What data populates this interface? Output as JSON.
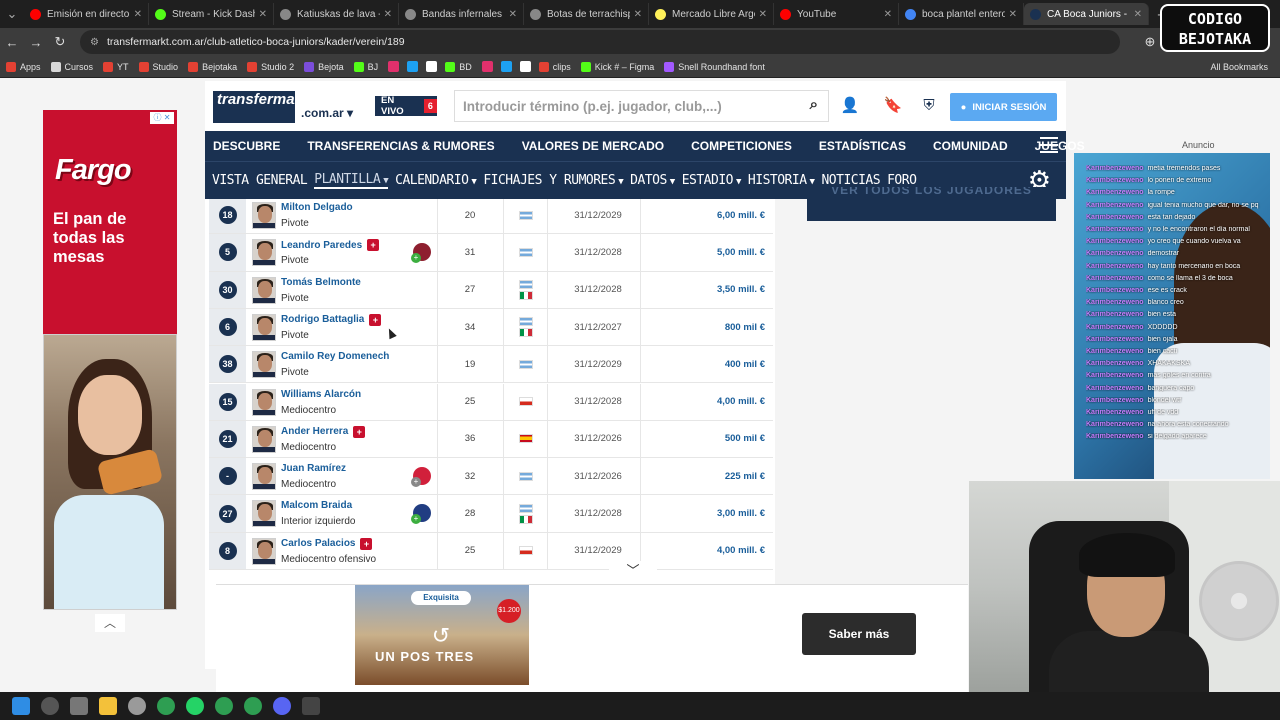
{
  "browser": {
    "tabs": [
      {
        "title": "Emisión en directo - Y",
        "color": "#ff0000"
      },
      {
        "title": "Stream - Kick Dashboard",
        "color": "#53fc18"
      },
      {
        "title": "Katiuskas de lava - W",
        "color": "#888888"
      },
      {
        "title": "Bandas infernales - W",
        "color": "#888888"
      },
      {
        "title": "Botas de terrachispa",
        "color": "#888888"
      },
      {
        "title": "Mercado Libre Argen",
        "color": "#fff159"
      },
      {
        "title": "YouTube",
        "color": "#ff0000"
      },
      {
        "title": "boca plantel entero",
        "color": "#4285f4"
      },
      {
        "title": "CA Boca Juniors - Pla",
        "color": "#1a3151",
        "active": true
      }
    ],
    "url": "transfermarkt.com.ar/club-atletico-boca-juniors/kader/verein/189",
    "bookmarks": [
      "Apps",
      "Cursos",
      "YT",
      "Studio",
      "Bejotaka",
      "Studio 2",
      "Bejota",
      "BJ",
      "BD",
      "clips",
      "Kick # – Figma",
      "Snell Roundhand font"
    ],
    "all_bookmarks": "All Bookmarks"
  },
  "stream_logo": {
    "line1": "CODIGO",
    "line2": "BEJOTAKA"
  },
  "ad_left": {
    "brand": "Fargo",
    "slogan": "El pan de todas las mesas"
  },
  "header": {
    "logo_text": "transfermarkt",
    "domain": ".com.ar",
    "live_label": "EN VIVO",
    "live_count": "6",
    "search_placeholder": "Introducir término (p.ej. jugador, club,...)",
    "login_label": "INICIAR SESIÓN"
  },
  "main_nav": [
    "DESCUBRE",
    "TRANSFERENCIAS & RUMORES",
    "VALORES DE MERCADO",
    "COMPETICIONES",
    "ESTADÍSTICAS",
    "COMUNIDAD",
    "JUEGOS"
  ],
  "sub_nav": [
    {
      "label": "VISTA GENERAL",
      "caret": false
    },
    {
      "label": "PLANTILLA",
      "caret": true,
      "active": true
    },
    {
      "label": "CALENDARIO",
      "caret": true
    },
    {
      "label": "FICHAJES Y RUMORES",
      "caret": true
    },
    {
      "label": "DATOS",
      "caret": true
    },
    {
      "label": "ESTADIO",
      "caret": true
    },
    {
      "label": "HISTORIA",
      "caret": true
    },
    {
      "label": "NOTICIAS",
      "caret": false
    },
    {
      "label": "FORO",
      "caret": false
    }
  ],
  "players": [
    {
      "number": "18",
      "name": "Milton Delgado",
      "position": "Pivote",
      "age": "20",
      "flags": [
        "ar"
      ],
      "contract": "31/12/2029",
      "value": "6,00 mill. €",
      "injury": false,
      "club": null
    },
    {
      "number": "5",
      "name": "Leandro Paredes",
      "position": "Pivote",
      "age": "31",
      "flags": [
        "ar"
      ],
      "contract": "31/12/2028",
      "value": "5,00 mill. €",
      "injury": true,
      "club": "roma"
    },
    {
      "number": "30",
      "name": "Tomás Belmonte",
      "position": "Pivote",
      "age": "27",
      "flags": [
        "ar",
        "it"
      ],
      "contract": "31/12/2028",
      "value": "3,50 mill. €",
      "injury": false,
      "club": null
    },
    {
      "number": "6",
      "name": "Rodrigo Battaglia",
      "position": "Pivote",
      "age": "34",
      "flags": [
        "ar",
        "it"
      ],
      "contract": "31/12/2027",
      "value": "800 mil €",
      "injury": true,
      "club": null
    },
    {
      "number": "38",
      "name": "Camilo Rey Domenech",
      "position": "Pivote",
      "age": "19",
      "flags": [
        "ar"
      ],
      "contract": "31/12/2029",
      "value": "400 mil €",
      "injury": false,
      "club": null
    },
    {
      "number": "15",
      "name": "Williams Alarcón",
      "position": "Mediocentro",
      "age": "25",
      "flags": [
        "cl"
      ],
      "contract": "31/12/2028",
      "value": "4,00 mill. €",
      "injury": false,
      "club": null
    },
    {
      "number": "21",
      "name": "Ander Herrera",
      "position": "Mediocentro",
      "age": "36",
      "flags": [
        "es"
      ],
      "contract": "31/12/2026",
      "value": "500 mil €",
      "injury": true,
      "club": null
    },
    {
      "number": "-",
      "name": "Juan Ramírez",
      "position": "Mediocentro",
      "age": "32",
      "flags": [
        "ar"
      ],
      "contract": "31/12/2026",
      "value": "225 mil €",
      "injury": false,
      "club": "estudiantes"
    },
    {
      "number": "27",
      "name": "Malcom Braida",
      "position": "Interior izquierdo",
      "age": "28",
      "flags": [
        "ar",
        "it"
      ],
      "contract": "31/12/2028",
      "value": "3,00 mill. €",
      "injury": false,
      "club": "sanlorenzo"
    },
    {
      "number": "8",
      "name": "Carlos Palacios",
      "position": "Mediocentro ofensivo",
      "age": "25",
      "flags": [
        "cl"
      ],
      "contract": "31/12/2029",
      "value": "4,00 mill. €",
      "injury": true,
      "club": null
    }
  ],
  "right_column": {
    "all_players_button": "VER TODOS LOS JUGADORES",
    "ad_label": "Anuncio"
  },
  "stream_chat": [
    {
      "user": "Karimbenzeweno",
      "msg": "metia tremendos pases"
    },
    {
      "user": "Karimbenzeweno",
      "msg": "lo ponen de extremo"
    },
    {
      "user": "Karimbenzeweno",
      "msg": "la rompe"
    },
    {
      "user": "Karimbenzeweno",
      "msg": "igual tenia mucho que dar, no se pq"
    },
    {
      "user": "Karimbenzeweno",
      "msg": "esta tan dejado"
    },
    {
      "user": "Karimbenzeweno",
      "msg": "y no le encontraron el día normal"
    },
    {
      "user": "Karimbenzeweno",
      "msg": "yo creo que cuando vuelva va"
    },
    {
      "user": "Karimbenzeweno",
      "msg": "demostrar"
    },
    {
      "user": "Karimbenzeweno",
      "msg": "hay tanto mercenario en boca"
    },
    {
      "user": "Karimbenzeweno",
      "msg": "como se llama el 3 de boca"
    },
    {
      "user": "Karimbenzeweno",
      "msg": "ese es crack"
    },
    {
      "user": "Karimbenzeweno",
      "msg": "blanco creo"
    },
    {
      "user": "Karimbenzeweno",
      "msg": "bien esta"
    },
    {
      "user": "Karimbenzeweno",
      "msg": "XDDDDD"
    },
    {
      "user": "Karimbenzeweno",
      "msg": "bien ojala"
    },
    {
      "user": "Karimbenzeweno",
      "msg": "bien cacti"
    },
    {
      "user": "Karimbenzeweno",
      "msg": "XHAKAKSKA"
    },
    {
      "user": "Karimbenzeweno",
      "msg": "más goles en contra"
    },
    {
      "user": "Karimbenzeweno",
      "msg": "banguera capo"
    },
    {
      "user": "Karimbenzeweno",
      "msg": "blondel wtf"
    },
    {
      "user": "Karimbenzeweno",
      "msg": "uff de vdd"
    },
    {
      "user": "Karimbenzeweno",
      "msg": "na ahora esta conectando"
    },
    {
      "user": "Karimbenzeweno",
      "msg": "si delgado aparece"
    }
  ],
  "bottom_ad": {
    "brand": "Exquisita",
    "price": "$1.200",
    "promo": "UN POS TRES",
    "cta": "Saber más"
  },
  "colors": {
    "tm_navy": "#1a3151",
    "tm_link": "#1a5e9a",
    "login_blue": "#5ba9f2",
    "injury_red": "#c8102e"
  }
}
